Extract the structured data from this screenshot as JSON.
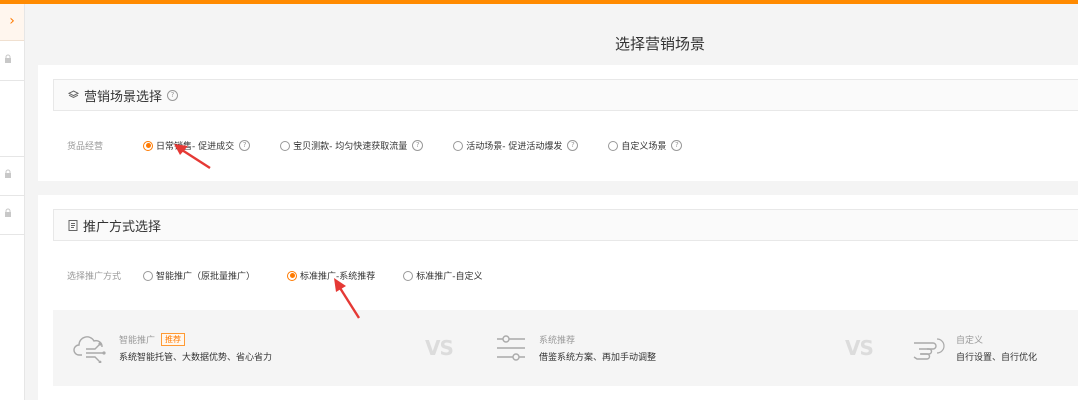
{
  "page": {
    "title": "选择营销场景"
  },
  "sidebar": {
    "toggle_glyph": "›"
  },
  "scene_section": {
    "title": "营销场景选择",
    "row_label": "货品经营",
    "options": [
      {
        "label": "日常销售- 促进成交",
        "checked": true
      },
      {
        "label": "宝贝测款- 均匀快速获取流量",
        "checked": false
      },
      {
        "label": "活动场景- 促进活动爆发",
        "checked": false
      },
      {
        "label": "自定义场景",
        "checked": false
      }
    ]
  },
  "method_section": {
    "title": "推广方式选择",
    "row_label": "选择推广方式",
    "options": [
      {
        "label": "智能推广（原批量推广）",
        "checked": false
      },
      {
        "label": "标准推广-系统推荐",
        "checked": true
      },
      {
        "label": "标准推广-自定义",
        "checked": false
      }
    ],
    "promo": [
      {
        "title": "智能推广",
        "badge": "推荐",
        "desc": "系统智能托管、大数据优势、省心省力",
        "icon": "cloud-icon"
      },
      {
        "title": "系统推荐",
        "desc": "借鉴系统方案、再加手动调整",
        "icon": "sliders-icon"
      },
      {
        "title": "自定义",
        "desc": "自行设置、自行优化",
        "icon": "hand-point-icon"
      }
    ],
    "vs_label": "VS"
  },
  "colors": {
    "accent": "#ff7a00",
    "top_bar": "#ff8a00",
    "arrow": "#e53935"
  }
}
